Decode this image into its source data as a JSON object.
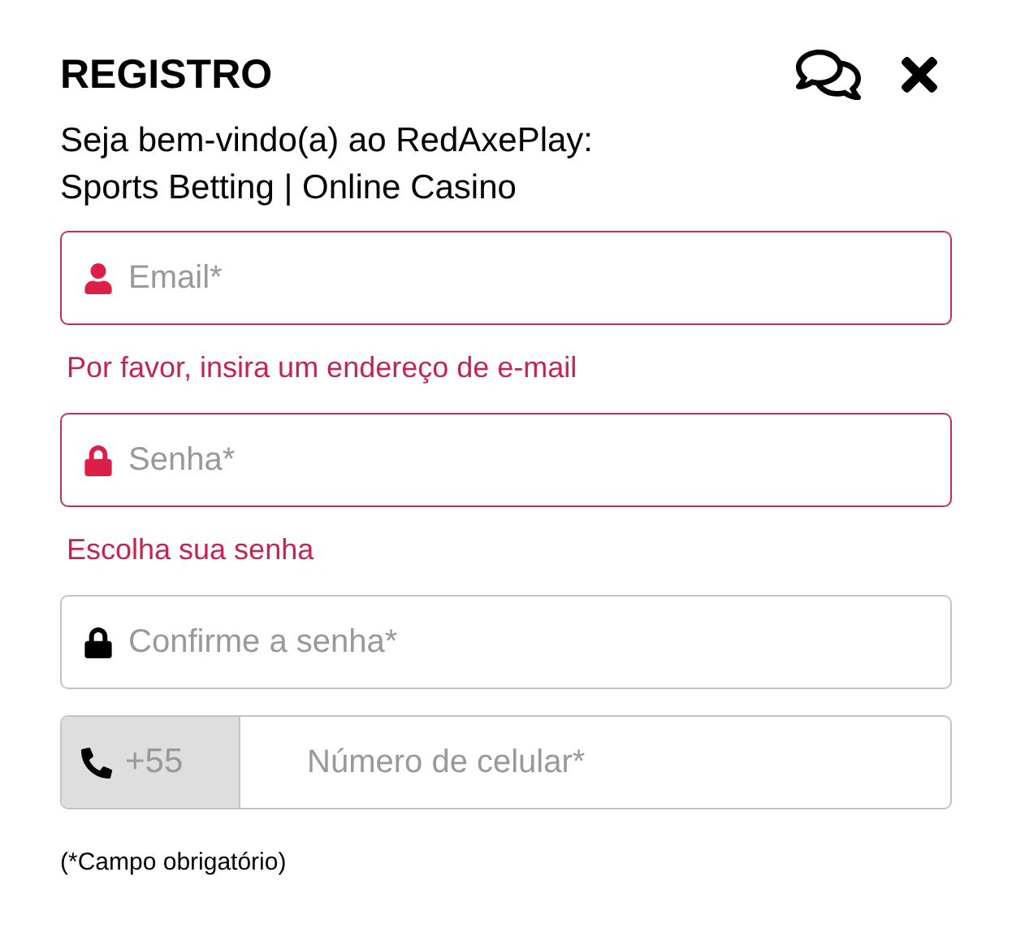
{
  "title": "REGISTRO",
  "welcome": [
    "Seja bem-vindo(a) ao RedAxePlay:",
    "Sports Betting | Online Casino"
  ],
  "fields": [
    {
      "kind": "email",
      "placeholder": "Email*",
      "invalid": true,
      "error": "Por favor, insira um endereço de e-mail"
    },
    {
      "kind": "password",
      "placeholder": "Senha*",
      "invalid": true,
      "error": "Escolha sua senha"
    },
    {
      "kind": "password",
      "placeholder": "Confirme a senha*",
      "invalid": false
    },
    {
      "kind": "phone",
      "prefix": "+55",
      "placeholder": "Número de celular*",
      "invalid": false
    }
  ],
  "note": "(*Campo obrigatório)"
}
